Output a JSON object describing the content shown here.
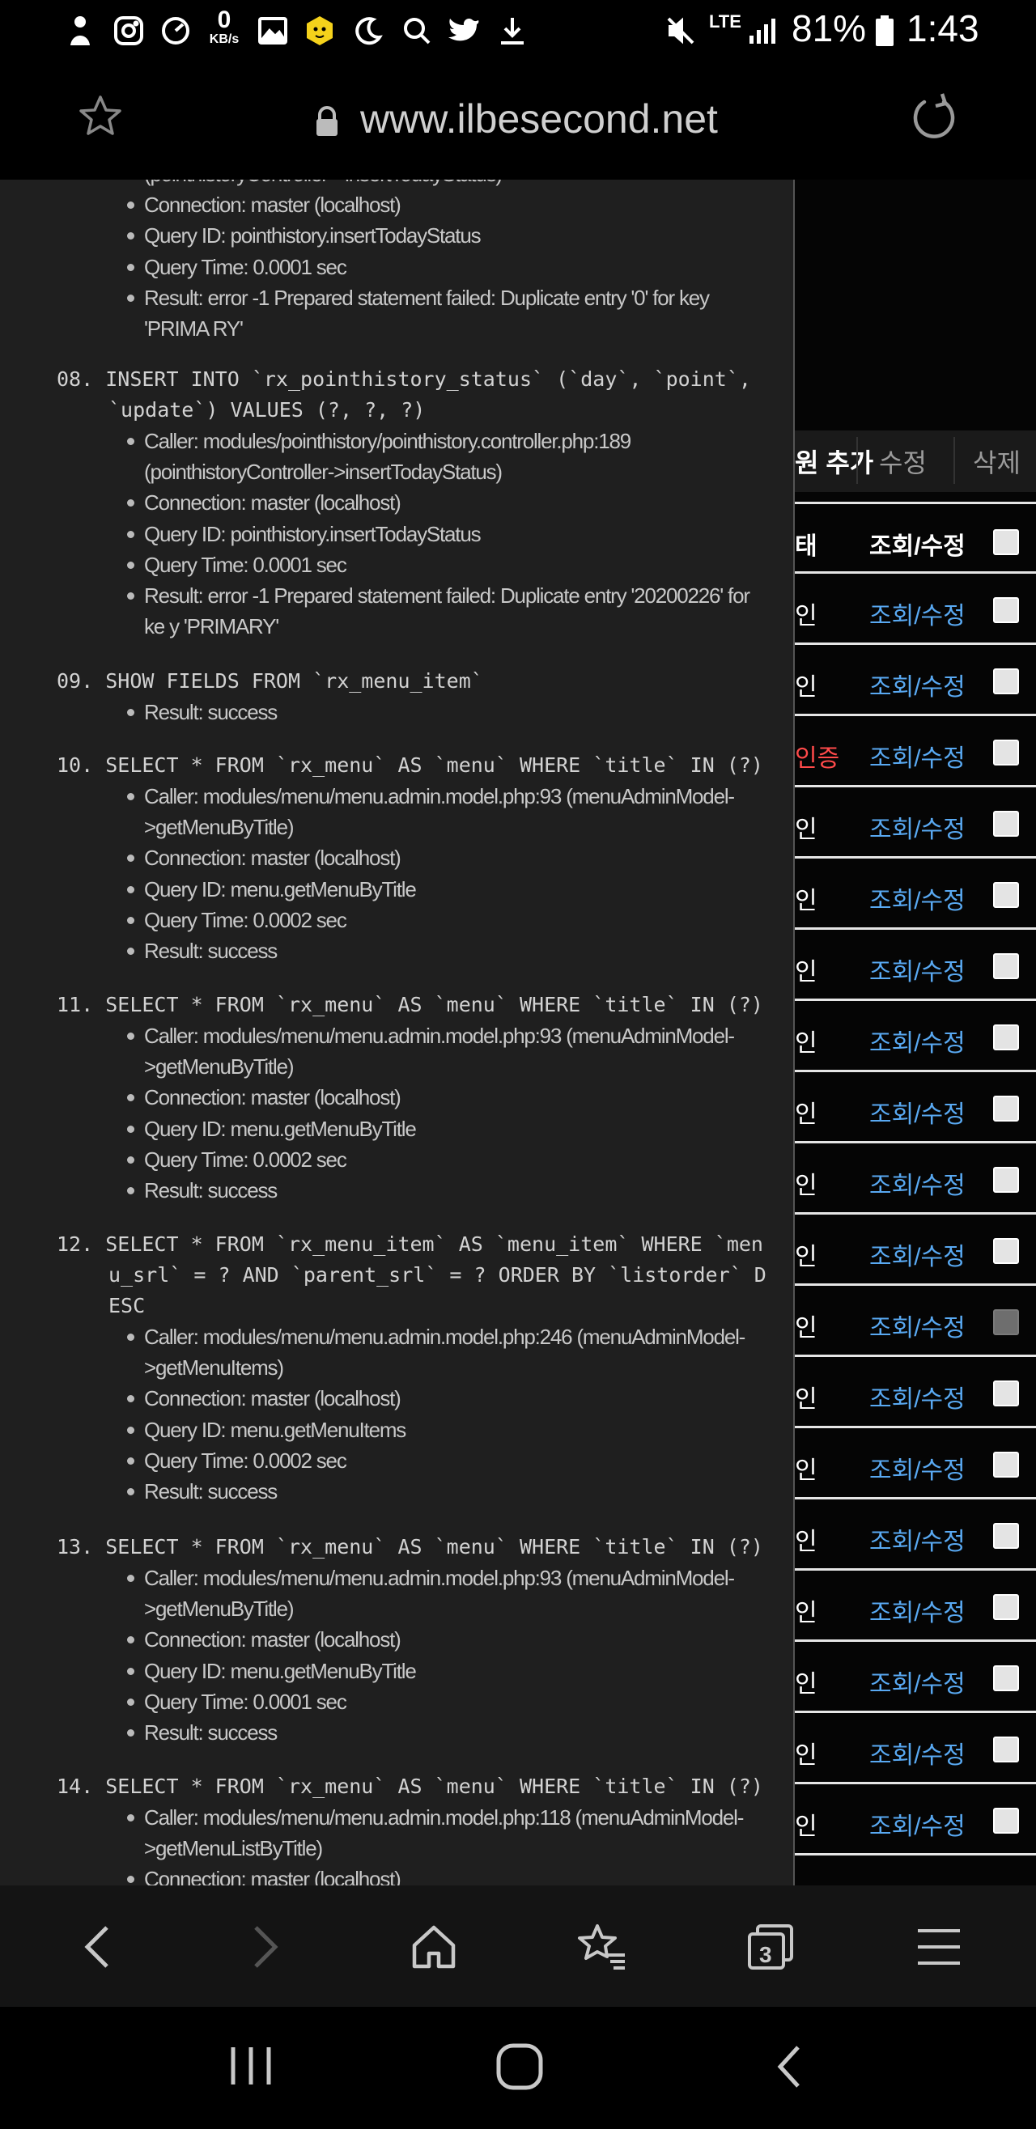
{
  "status_bar": {
    "speed_value": "0",
    "speed_unit": "KB/s",
    "network": "LTE",
    "battery": "81%",
    "time": "1:43",
    "icons": [
      "notification-person-icon",
      "instagram-icon",
      "speedometer-icon",
      "gallery-icon",
      "bear-app-icon",
      "moon-icon",
      "search-icon",
      "twitter-icon",
      "download-icon",
      "mute-icon",
      "signal-icon",
      "battery-icon"
    ]
  },
  "browser": {
    "url": "www.ilbesecond.net"
  },
  "debug": {
    "top_partial": "(pointhistoryController->insertTodayStatus)",
    "top_items": [
      "Connection: master (localhost)",
      "Query ID: pointhistory.insertTodayStatus",
      "Query Time: 0.0001 sec",
      "Result: error -1 Prepared statement failed: Duplicate entry '0' for key 'PRIMA RY'"
    ],
    "queries": [
      {
        "num": "08.",
        "sql": "INSERT INTO `rx_pointhistory_status` (`day`, `point`, `update`) VALUES (?, ?, ?)",
        "items": [
          "Caller: modules/pointhistory/pointhistory.controller.php:189 (pointhistoryController->insertTodayStatus)",
          "Connection: master (localhost)",
          "Query ID: pointhistory.insertTodayStatus",
          "Query Time: 0.0001 sec",
          "Result: error -1 Prepared statement failed: Duplicate entry '20200226' for ke y 'PRIMARY'"
        ]
      },
      {
        "num": "09.",
        "sql": "SHOW FIELDS FROM `rx_menu_item`",
        "items": [
          "Result: success"
        ]
      },
      {
        "num": "10.",
        "sql": "SELECT * FROM `rx_menu` AS `menu` WHERE `title` IN (?)",
        "items": [
          "Caller: modules/menu/menu.admin.model.php:93 (menuAdminModel->getMenuByTitle)",
          "Connection: master (localhost)",
          "Query ID: menu.getMenuByTitle",
          "Query Time: 0.0002 sec",
          "Result: success"
        ]
      },
      {
        "num": "11.",
        "sql": "SELECT * FROM `rx_menu` AS `menu` WHERE `title` IN (?)",
        "items": [
          "Caller: modules/menu/menu.admin.model.php:93 (menuAdminModel->getMenuByTitle)",
          "Connection: master (localhost)",
          "Query ID: menu.getMenuByTitle",
          "Query Time: 0.0002 sec",
          "Result: success"
        ]
      },
      {
        "num": "12.",
        "sql": "SELECT * FROM `rx_menu_item` AS `menu_item` WHERE `menu_srl` = ? AND `parent_srl` = ? ORDER BY `listorder` DESC",
        "items": [
          "Caller: modules/menu/menu.admin.model.php:246 (menuAdminModel->getMenuItems)",
          "Connection: master (localhost)",
          "Query ID: menu.getMenuItems",
          "Query Time: 0.0002 sec",
          "Result: success"
        ]
      },
      {
        "num": "13.",
        "sql": "SELECT * FROM `rx_menu` AS `menu` WHERE `title` IN (?)",
        "items": [
          "Caller: modules/menu/menu.admin.model.php:93 (menuAdminModel->getMenuByTitle)",
          "Connection: master (localhost)",
          "Query ID: menu.getMenuByTitle",
          "Query Time: 0.0001 sec",
          "Result: success"
        ]
      },
      {
        "num": "14.",
        "sql": "SELECT * FROM `rx_menu` AS `menu` WHERE `title` IN (?)",
        "items": [
          "Caller: modules/menu/menu.admin.model.php:118 (menuAdminModel->getMenuListByTitle)",
          "Connection: master (localhost)"
        ]
      }
    ]
  },
  "admin": {
    "tabs": {
      "add": "원 추가",
      "edit": "수정",
      "delete": "삭제"
    },
    "header": {
      "status": "태",
      "view_edit": "조회/수정"
    },
    "rows": [
      {
        "status": "인",
        "link": "조회/수정",
        "checked": false,
        "warn": false
      },
      {
        "status": "인",
        "link": "조회/수정",
        "checked": false,
        "warn": false
      },
      {
        "status": "인증",
        "link": "조회/수정",
        "checked": false,
        "warn": true
      },
      {
        "status": "인",
        "link": "조회/수정",
        "checked": false,
        "warn": false
      },
      {
        "status": "인",
        "link": "조회/수정",
        "checked": false,
        "warn": false
      },
      {
        "status": "인",
        "link": "조회/수정",
        "checked": false,
        "warn": false
      },
      {
        "status": "인",
        "link": "조회/수정",
        "checked": false,
        "warn": false
      },
      {
        "status": "인",
        "link": "조회/수정",
        "checked": false,
        "warn": false
      },
      {
        "status": "인",
        "link": "조회/수정",
        "checked": false,
        "warn": false
      },
      {
        "status": "인",
        "link": "조회/수정",
        "checked": false,
        "warn": false
      },
      {
        "status": "인",
        "link": "조회/수정",
        "checked": false,
        "warn": false,
        "disabled": true
      },
      {
        "status": "인",
        "link": "조회/수정",
        "checked": false,
        "warn": false
      },
      {
        "status": "인",
        "link": "조회/수정",
        "checked": false,
        "warn": false
      },
      {
        "status": "인",
        "link": "조회/수정",
        "checked": false,
        "warn": false
      },
      {
        "status": "인",
        "link": "조회/수정",
        "checked": false,
        "warn": false
      },
      {
        "status": "인",
        "link": "조회/수정",
        "checked": false,
        "warn": false
      },
      {
        "status": "인",
        "link": "조회/수정",
        "checked": false,
        "warn": false
      },
      {
        "status": "인",
        "link": "조회/수정",
        "checked": false,
        "warn": false
      }
    ]
  },
  "bottom_nav": {
    "tab_count": "3"
  },
  "colors": {
    "link": "#59a9f2",
    "warn": "#ff4a4a",
    "panel": "#1f1f1f"
  }
}
